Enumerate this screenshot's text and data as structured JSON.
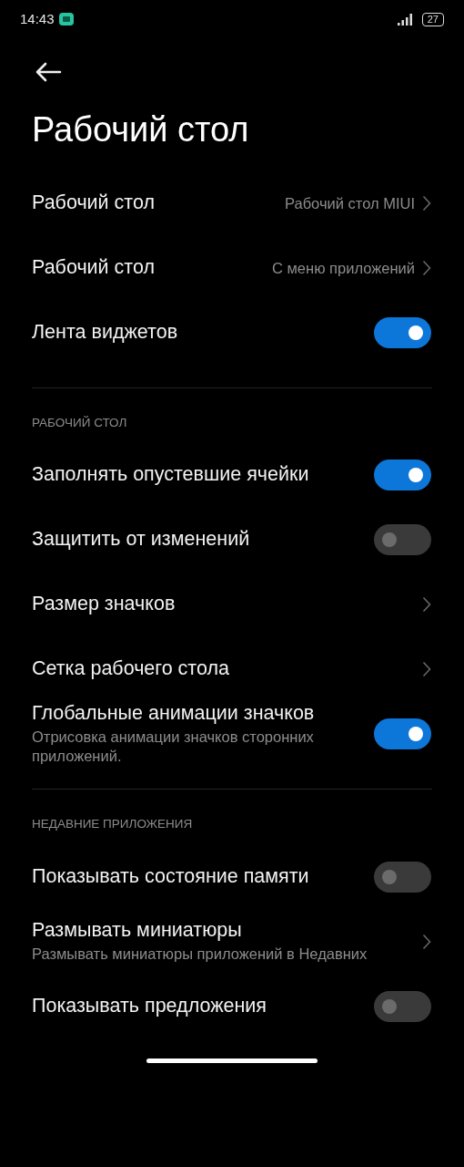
{
  "status_bar": {
    "time": "14:43",
    "battery": "27"
  },
  "title": "Рабочий стол",
  "sections": [
    {
      "items": [
        {
          "kind": "link",
          "label": "Рабочий стол",
          "value": "Рабочий стол MIUI"
        },
        {
          "kind": "link",
          "label": "Рабочий стол",
          "value": "С меню приложений"
        },
        {
          "kind": "toggle",
          "label": "Лента виджетов",
          "on": true
        }
      ]
    },
    {
      "header": "РАБОЧИЙ СТОЛ",
      "items": [
        {
          "kind": "toggle",
          "label": "Заполнять опустевшие ячейки",
          "on": true
        },
        {
          "kind": "toggle",
          "label": "Защитить от изменений",
          "on": false
        },
        {
          "kind": "link",
          "label": "Размер значков"
        },
        {
          "kind": "link",
          "label": "Сетка рабочего стола"
        },
        {
          "kind": "toggle",
          "label": "Глобальные анимации значков",
          "subtitle": "Отрисовка анимации значков сторонних приложений.",
          "on": true
        }
      ]
    },
    {
      "header": "НЕДАВНИЕ ПРИЛОЖЕНИЯ",
      "items": [
        {
          "kind": "toggle",
          "label": "Показывать состояние памяти",
          "on": false
        },
        {
          "kind": "link",
          "label": "Размывать миниатюры",
          "subtitle": "Размывать миниатюры приложений в Недавних"
        },
        {
          "kind": "toggle",
          "label": "Показывать предложения",
          "on": false
        }
      ]
    }
  ]
}
